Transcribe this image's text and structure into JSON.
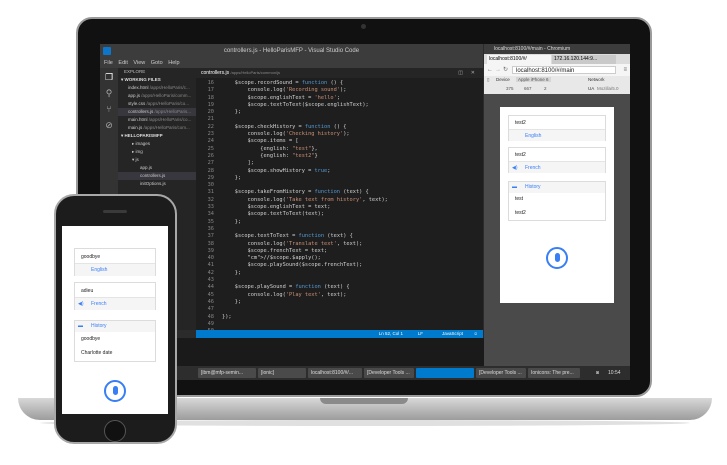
{
  "vscode": {
    "title": "controllers.js - HelloParisMFP - Visual Studio Code",
    "menu": [
      "File",
      "Edit",
      "View",
      "Goto",
      "Help"
    ],
    "explorer_title": "EXPLORE",
    "working_files_header": "▾ WORKING FILES",
    "working_files": [
      {
        "name": "index.html",
        "path": "/apps/HelloParis/c..."
      },
      {
        "name": "app.js",
        "path": "/apps/HelloParis/comm..."
      },
      {
        "name": "style.css",
        "path": "/apps/HelloParis/co..."
      },
      {
        "name": "controllers.js",
        "path": "/apps/HelloParis..."
      },
      {
        "name": "main.html",
        "path": "/apps/HelloParis/co..."
      },
      {
        "name": "main.js",
        "path": "/apps/HelloParis/com..."
      }
    ],
    "project_header": "▾ HELLOPARISMFP",
    "tree": [
      "▸ images",
      "▸ img",
      "▾ js",
      "app.js",
      "controllers.js",
      "initOptions.js"
    ],
    "tab_label": "controllers.js",
    "tab_path": "/apps/HelloParis/common/js",
    "status": {
      "position": "Ln 52, Col 1",
      "eol": "LF",
      "language": "JavaScript"
    },
    "code_lines": [
      {
        "n": "16",
        "text": "    $scope.recordSound = function () {"
      },
      {
        "n": "17",
        "text": "        console.log('Recording sound');"
      },
      {
        "n": "18",
        "text": "        $scope.englishText = 'hello';"
      },
      {
        "n": "19",
        "text": "        $scope.textToText($scope.englishText);"
      },
      {
        "n": "20",
        "text": "    };"
      },
      {
        "n": "21",
        "text": ""
      },
      {
        "n": "22",
        "text": "    $scope.checkHistory = function () {"
      },
      {
        "n": "23",
        "text": "        console.log('Checking history');"
      },
      {
        "n": "24",
        "text": "        $scope.items = ["
      },
      {
        "n": "25",
        "text": "            {english: \"test\"},"
      },
      {
        "n": "26",
        "text": "            {english: \"test2\"}"
      },
      {
        "n": "27",
        "text": "        ];"
      },
      {
        "n": "28",
        "text": "        $scope.showHistory = true;"
      },
      {
        "n": "29",
        "text": "    };"
      },
      {
        "n": "30",
        "text": ""
      },
      {
        "n": "31",
        "text": "    $scope.takeFromHistory = function (text) {"
      },
      {
        "n": "32",
        "text": "        console.log('Take text from history', text);"
      },
      {
        "n": "33",
        "text": "        $scope.englishText = text;"
      },
      {
        "n": "34",
        "text": "        $scope.textToText(text);"
      },
      {
        "n": "35",
        "text": "    };"
      },
      {
        "n": "36",
        "text": ""
      },
      {
        "n": "37",
        "text": "    $scope.textToText = function (text) {"
      },
      {
        "n": "38",
        "text": "        console.log('Translate text', text);"
      },
      {
        "n": "39",
        "text": "        $scope.frenchText = text;"
      },
      {
        "n": "40",
        "text": "        //$scope.$apply();"
      },
      {
        "n": "41",
        "text": "        $scope.playSound($scope.frenchText);"
      },
      {
        "n": "42",
        "text": "    };"
      },
      {
        "n": "43",
        "text": ""
      },
      {
        "n": "44",
        "text": "    $scope.playSound = function (text) {"
      },
      {
        "n": "45",
        "text": "        console.log('Play text', text);"
      },
      {
        "n": "46",
        "text": "    };"
      },
      {
        "n": "47",
        "text": ""
      },
      {
        "n": "48",
        "text": "});"
      },
      {
        "n": "49",
        "text": ""
      },
      {
        "n": "50",
        "text": ""
      },
      {
        "n": "51",
        "text": ""
      }
    ],
    "line_52": "52"
  },
  "chromium": {
    "title": "localhost:8100/#/main - Chromium",
    "tabs": [
      "localhost:8100/#/",
      "172.16.120.144:9..."
    ],
    "url": "localhost:8100/#/main",
    "device_label": "Device",
    "device_value": "Apple iPhone 6",
    "network_label": "Network",
    "network_value": "No throttling",
    "dims": "375",
    "dims2": "667",
    "zoom": "2",
    "ua": "UA",
    "ua_value": "Mozilla/5.0",
    "app": {
      "card1_text": "test2",
      "card1_sub": "English",
      "card2_text": "test2",
      "card2_sub": "French",
      "history_label": "History",
      "history_items": [
        "test",
        "test2"
      ]
    }
  },
  "taskbar": {
    "items": [
      "[ibm@mfp-semin...",
      "[ionic]",
      "localhost:8100/#/...",
      "[Developer Tools ...",
      "",
      "[Developer Tools ...",
      "Ionicons: The pre..."
    ],
    "time": "10:54"
  },
  "phone": {
    "card1_text": "goodbye",
    "card1_sub": "English",
    "card2_text": "adieu",
    "card2_sub": "French",
    "history_label": "History",
    "history_items": [
      "goodbye",
      "Charlotte date"
    ]
  },
  "colors": {
    "accent": "#387ef5",
    "vscode_blue": "#007acc"
  }
}
